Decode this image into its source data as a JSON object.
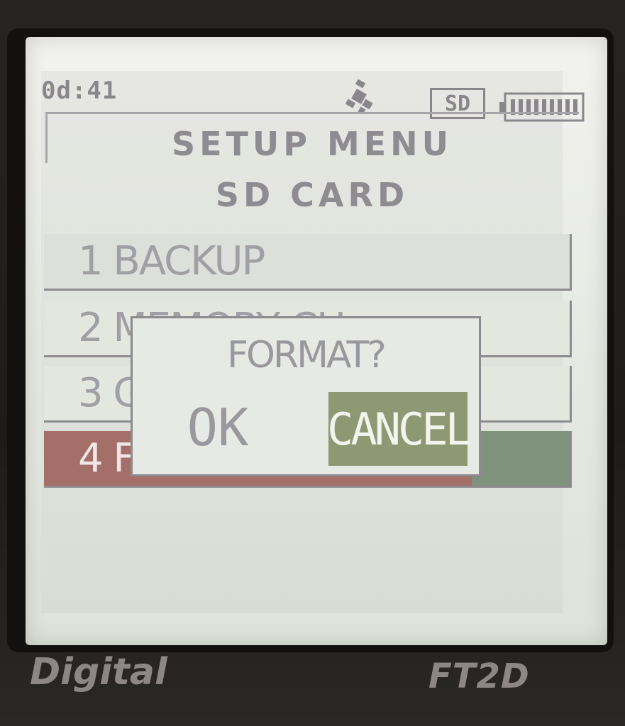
{
  "status_bar": {
    "clock": "0d:41",
    "gps_icon": "gps-satellite-icon",
    "sd_label": "SD",
    "battery_icon": "battery-full-icon"
  },
  "header": {
    "title": "SETUP MENU",
    "subtitle": "SD CARD"
  },
  "menu": {
    "items": [
      {
        "label": "1 BACKUP"
      },
      {
        "label": "2 MEMORY CH"
      },
      {
        "label": "3 G"
      },
      {
        "label": "4 F"
      }
    ],
    "selected_index": 3
  },
  "dialog": {
    "title": "FORMAT?",
    "ok_label": "OK",
    "cancel_label": "CANCEL",
    "focused": "cancel"
  },
  "device": {
    "brand_left": "Digital",
    "brand_right": "FT2D"
  },
  "colors": {
    "selection_highlight": "#a36f68",
    "focused_button": "#8e9873",
    "text": "#9a979d"
  }
}
